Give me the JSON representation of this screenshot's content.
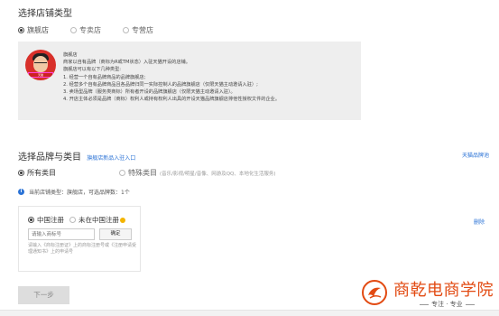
{
  "store_type": {
    "title": "选择店铺类型",
    "options": [
      {
        "label": "旗舰店",
        "selected": true
      },
      {
        "label": "专卖店",
        "selected": false
      },
      {
        "label": "专营店",
        "selected": false
      }
    ]
  },
  "info": {
    "avatar_plate": "天猫",
    "lines": [
      "旗舰店",
      "商家以自有品牌（商标为R或TM状态）入驻天猫开设的店铺。",
      "旗舰店可以有以下几种类型:",
      "1. 经营一个自有品牌商品的品牌旗舰店;",
      "2. 经营多个自有品牌商品且各品牌归同一实际控制人的品牌旗舰店（仅限天猫主动邀请入驻）;",
      "3. 卖场型品牌（服务类商标）所有者开设的品牌旗舰店（仅限天猫主动邀请入驻）。",
      "4. 开店主体必须是品牌（商标）权利人或持有权利人出具的开设天猫品牌旗舰店排他性授权文件的企业。"
    ]
  },
  "brand": {
    "title": "选择品牌与类目",
    "new_brand_link": "旗舰店新品入驻入口",
    "brand_standard_link": "天猫品牌池",
    "options": [
      {
        "label": "所有类目",
        "selected": true
      },
      {
        "label": "特殊类目",
        "selected": false,
        "hint": "(音乐/影视/明星/音像、网游及QQ、本地化生活服务)"
      }
    ]
  },
  "notice": {
    "icon": "i",
    "text": "当前店铺类型：旗舰店，可选品牌数：1个"
  },
  "card": {
    "options": [
      {
        "label": "中国注册",
        "selected": true
      },
      {
        "label": "未在中国注册",
        "selected": false
      }
    ],
    "input_placeholder": "请输入商标号",
    "confirm_label": "确定",
    "help": "请输入《商标注册证》上的商标注册号或《注册申请受理通知书》上的申请号"
  },
  "delete_label": "删除",
  "next_label": "下一步",
  "watermark": {
    "name": "商乾电商学院",
    "slogan": "专注 · 专业",
    "color": "#e24a12"
  },
  "colors": {
    "link": "#2b73d6",
    "panel_bg": "#eeeeee"
  }
}
